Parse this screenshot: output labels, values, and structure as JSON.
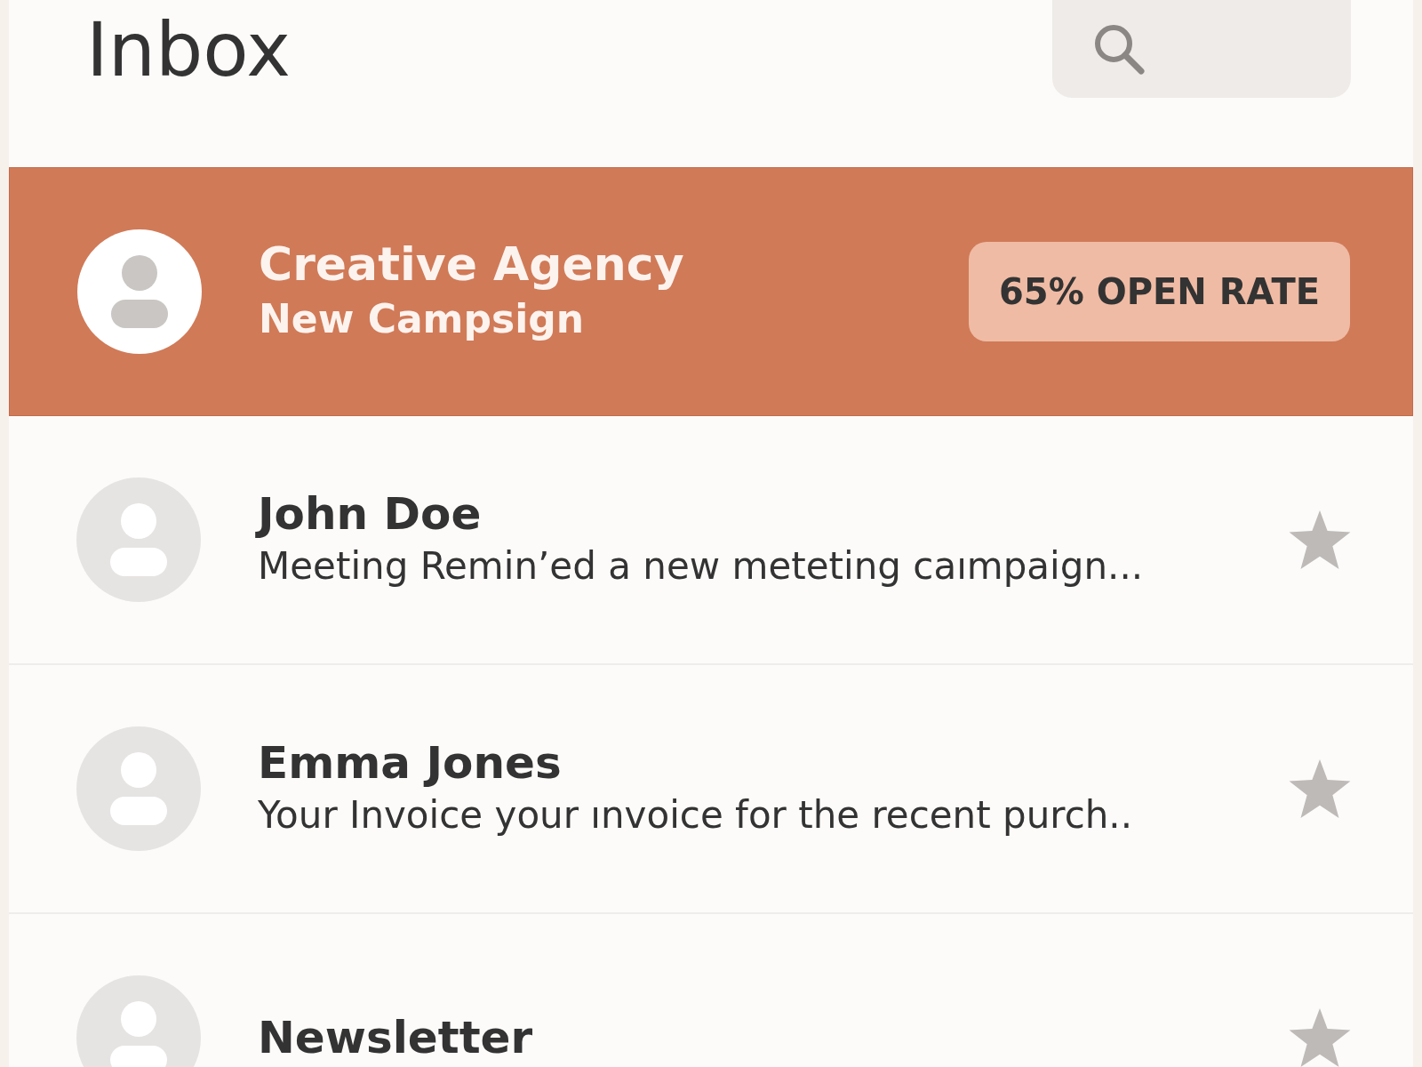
{
  "header": {
    "title": "Inbox"
  },
  "messages": [
    {
      "sender": "Creative Agency",
      "preview": "New Campsign",
      "selected": true,
      "badge": "65% OPEN RATE"
    },
    {
      "sender": "John Doe",
      "preview": "Meeting Remin’ed a new meteting caımpaign...",
      "selected": false
    },
    {
      "sender": "Emma Jones",
      "preview": "Your Invoice your ınvoice for the recent purch..",
      "selected": false
    },
    {
      "sender": "Newsletter",
      "selected": false
    }
  ]
}
